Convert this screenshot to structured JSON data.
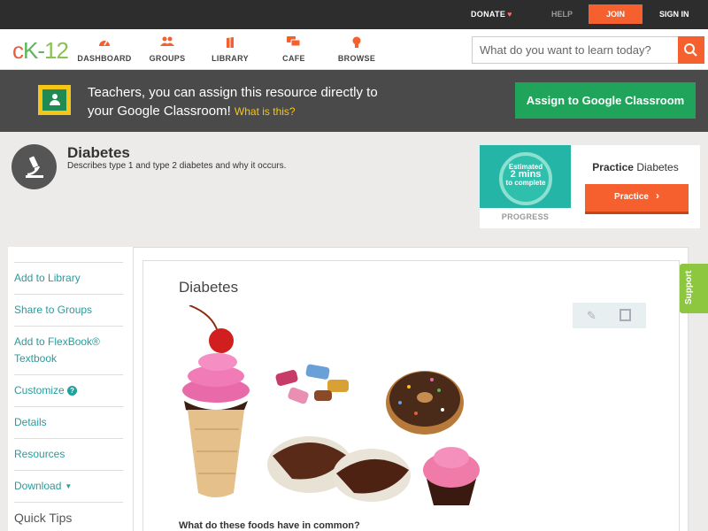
{
  "topbar": {
    "donate": "DONATE",
    "help": "HELP",
    "join": "JOIN",
    "signin": "SIGN IN"
  },
  "logo": {
    "c": "c",
    "k": "K",
    "dash": "-",
    "n": "12"
  },
  "nav": [
    {
      "label": "DASHBOARD",
      "icon": "dashboard-icon"
    },
    {
      "label": "GROUPS",
      "icon": "groups-icon"
    },
    {
      "label": "LIBRARY",
      "icon": "library-icon"
    },
    {
      "label": "CAFE",
      "icon": "cafe-icon"
    },
    {
      "label": "BROWSE",
      "icon": "browse-icon"
    }
  ],
  "search": {
    "placeholder": "What do you want to learn today?"
  },
  "banner": {
    "text": "Teachers, you can assign this resource directly to your Google Classroom!",
    "link": "What is this?",
    "assign": "Assign to Google Classroom"
  },
  "concept": {
    "title": "Diabetes",
    "description": "Describes type 1 and type 2 diabetes and why it occurs."
  },
  "practice": {
    "estimated": "Estimated",
    "mins": "2 mins",
    "to_complete": "to complete",
    "progress_label": "PROGRESS",
    "heading_bold": "Practice",
    "heading_rest": "Diabetes",
    "button": "Practice"
  },
  "sidebar": {
    "items": [
      "Add to Library",
      "Share to Groups",
      "Add to FlexBook®",
      "Textbook",
      "Customize",
      "Details",
      "Resources",
      "Download",
      "Quick Tips"
    ]
  },
  "content": {
    "title": "Diabetes",
    "caption": "What do these foods have in common?"
  },
  "support": "Support",
  "colors": {
    "accent": "#f5602e",
    "green": "#20a35a",
    "teal": "#2a9b9b",
    "support": "#8dc63f"
  }
}
